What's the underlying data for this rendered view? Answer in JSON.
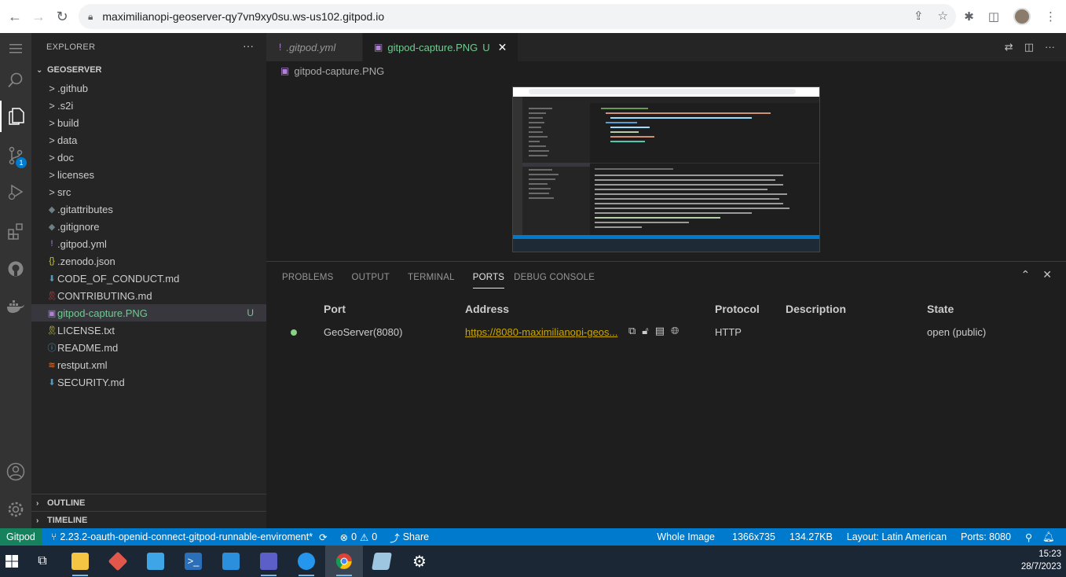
{
  "browser": {
    "url": "maximilianopi-geoserver-qy7vn9xy0su.ws-us102.gitpod.io"
  },
  "activity_bar": {
    "scm_badge": "1"
  },
  "sidebar": {
    "title": "EXPLORER",
    "more": "···",
    "root": "GEOSERVER",
    "items": [
      {
        "label": ".github",
        "type": "folder",
        "icon": ">"
      },
      {
        "label": ".s2i",
        "type": "folder",
        "icon": ">"
      },
      {
        "label": "build",
        "type": "folder",
        "icon": ">"
      },
      {
        "label": "data",
        "type": "folder",
        "icon": ">"
      },
      {
        "label": "doc",
        "type": "folder",
        "icon": ">"
      },
      {
        "label": "licenses",
        "type": "folder",
        "icon": ">"
      },
      {
        "label": "src",
        "type": "folder",
        "icon": ">"
      },
      {
        "label": ".gitattributes",
        "type": "file",
        "icon": "◆"
      },
      {
        "label": ".gitignore",
        "type": "file",
        "icon": "◆"
      },
      {
        "label": ".gitpod.yml",
        "type": "file",
        "icon": "!"
      },
      {
        "label": ".zenodo.json",
        "type": "file",
        "icon": "{}"
      },
      {
        "label": "CODE_OF_CONDUCT.md",
        "type": "file",
        "icon": "⬇"
      },
      {
        "label": "CONTRIBUTING.md",
        "type": "file",
        "icon": "🎗"
      },
      {
        "label": "gitpod-capture.PNG",
        "type": "file",
        "icon": "▣",
        "git": "U"
      },
      {
        "label": "LICENSE.txt",
        "type": "file",
        "icon": "🎗"
      },
      {
        "label": "README.md",
        "type": "file",
        "icon": "ⓘ"
      },
      {
        "label": "restput.xml",
        "type": "file",
        "icon": "≋"
      },
      {
        "label": "SECURITY.md",
        "type": "file",
        "icon": "⬇"
      }
    ],
    "outline": "OUTLINE",
    "timeline": "TIMELINE"
  },
  "editor": {
    "tabs": [
      {
        "label": ".gitpod.yml",
        "icon": "!"
      },
      {
        "label": "gitpod-capture.PNG",
        "icon": "▣",
        "git": "U",
        "close": "✕"
      }
    ],
    "breadcrumb": "gitpod-capture.PNG"
  },
  "panel": {
    "tabs": [
      "PROBLEMS",
      "OUTPUT",
      "TERMINAL",
      "PORTS",
      "DEBUG CONSOLE"
    ],
    "active_tab": "PORTS",
    "columns": {
      "port": "Port",
      "address": "Address",
      "protocol": "Protocol",
      "description": "Description",
      "state": "State"
    },
    "rows": [
      {
        "port": "GeoServer(8080)",
        "address": "https://8080-maximilianopi-geos...",
        "protocol": "HTTP",
        "description": "",
        "state": "open (public)"
      }
    ]
  },
  "statusbar": {
    "remote": "Gitpod",
    "branch": "2.23.2-oauth-openid-connect-gitpod-runnable-enviroment*",
    "errors": "0",
    "warnings": "0",
    "share": "Share",
    "view": "Whole Image",
    "dimensions": "1366x735",
    "size": "134.27KB",
    "layout": "Layout: Latin American",
    "ports": "Ports: 8080"
  },
  "taskbar": {
    "time": "15:23",
    "date": "28/7/2023"
  },
  "colors": {
    "accent": "#007acc",
    "remote": "#16825d",
    "untracked": "#73c991",
    "link": "#cca700"
  }
}
